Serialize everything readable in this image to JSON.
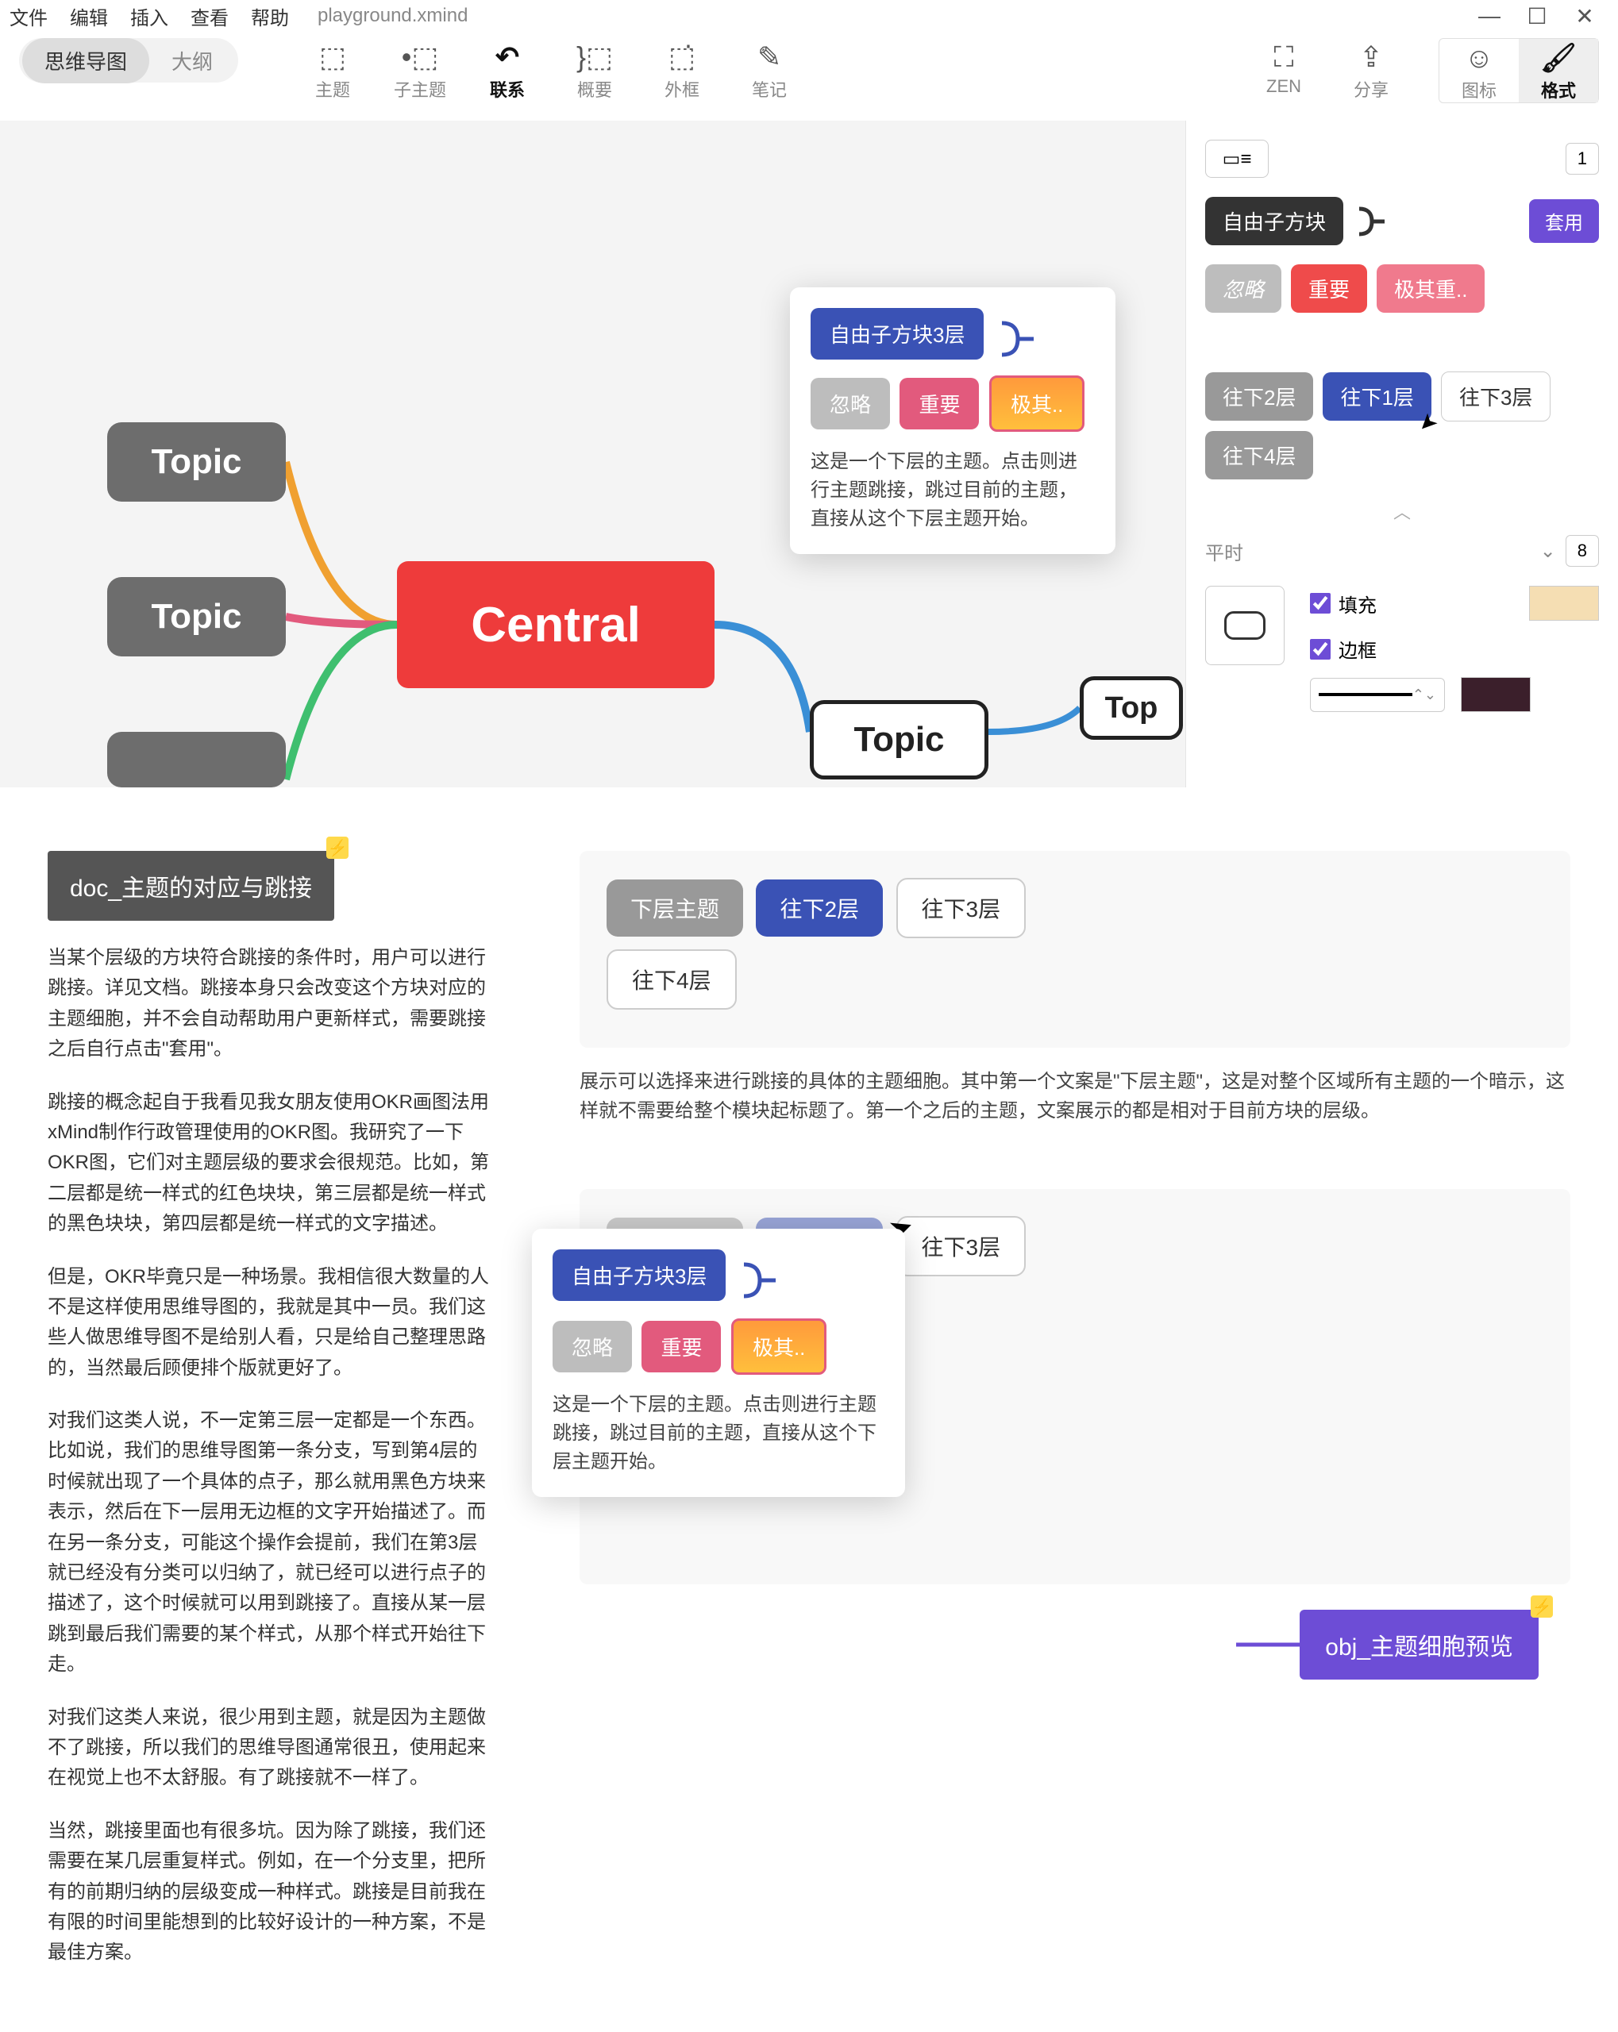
{
  "menu": {
    "file": "文件",
    "edit": "编辑",
    "insert": "插入",
    "view": "查看",
    "help": "帮助",
    "filename": "playground.xmind"
  },
  "toolbar": {
    "mindmap": "思维导图",
    "outline": "大纲",
    "topic": "主题",
    "subtopic": "子主题",
    "relation": "联系",
    "summary": "概要",
    "boundary": "外框",
    "note": "笔记",
    "zen": "ZEN",
    "share": "分享",
    "icon": "图标",
    "format": "格式"
  },
  "canvas": {
    "central": "Central",
    "topic": "Topic",
    "popup_title": "自由子方块3层",
    "chip_ignore": "忽略",
    "chip_important": "重要",
    "chip_very": "极其..",
    "popup_desc": "这是一个下层的主题。点击则进行主题跳接，跳过目前的主题，直接从这个下层主题开始。"
  },
  "sidebar": {
    "count1": "1",
    "free_block": "自由子方块",
    "apply": "套用",
    "ignore": "忽略",
    "important": "重要",
    "very": "极其重..",
    "down2": "往下2层",
    "down1": "往下1层",
    "down3": "往下3层",
    "down4": "往下4层",
    "normal": "平时",
    "count8": "8",
    "fill": "填充",
    "border": "边框"
  },
  "doc": {
    "title": "doc_主题的对应与跳接",
    "p1": "当某个层级的方块符合跳接的条件时，用户可以进行跳接。详见文档。跳接本身只会改变这个方块对应的主题细胞，并不会自动帮助用户更新样式，需要跳接之后自行点击\"套用\"。",
    "p2": "跳接的概念起自于我看见我女朋友使用OKR画图法用xMind制作行政管理使用的OKR图。我研究了一下OKR图，它们对主题层级的要求会很规范。比如，第二层都是统一样式的红色块块，第三层都是统一样式的黑色块块，第四层都是统一样式的文字描述。",
    "p3": "但是，OKR毕竟只是一种场景。我相信很大数量的人不是这样使用思维导图的，我就是其中一员。我们这些人做思维导图不是给别人看，只是给自己整理思路的，当然最后顾便排个版就更好了。",
    "p4": "对我们这类人说，不一定第三层一定都是一个东西。比如说，我们的思维导图第一条分支，写到第4层的时候就出现了一个具体的点子，那么就用黑色方块来表示，然后在下一层用无边框的文字开始描述了。而在另一条分支，可能这个操作会提前，我们在第3层就已经没有分类可以归纳了，就已经可以进行点子的描述了，这个时候就可以用到跳接了。直接从某一层跳到最后我们需要的某个样式，从那个样式开始往下走。",
    "p5": "对我们这类人来说，很少用到主题，就是因为主题做不了跳接，所以我们的思维导图通常很丑，使用起来在视觉上也不太舒服。有了跳接就不一样了。",
    "p6": "当然，跳接里面也有很多坑。因为除了跳接，我们还需要在某几层重复样式。例如，在一个分支里，把所有的前期归纳的层级变成一种样式。跳接是目前我在有限的时间里能想到的比较好设计的一种方案，不是最佳方案。"
  },
  "rightcard": {
    "lower_topic": "下层主题",
    "down2": "往下2层",
    "down3": "往下3层",
    "down4": "往下4层",
    "note": "展示可以选择来进行跳接的具体的主题细胞。其中第一个文案是\"下层主题\"，这是对整个区域所有主题的一个暗示，这样就不需要给整个模块起标题了。第一个之后的主题，文案展示的都是相对于目前方块的层级。",
    "popup_title": "自由子方块3层",
    "chip_ignore": "忽略",
    "chip_important": "重要",
    "chip_very": "极其..",
    "popup_desc": "这是一个下层的主题。点击则进行主题跳接，跳过目前的主题，直接从这个下层主题开始。",
    "obj_title": "obj_主题细胞预览"
  }
}
